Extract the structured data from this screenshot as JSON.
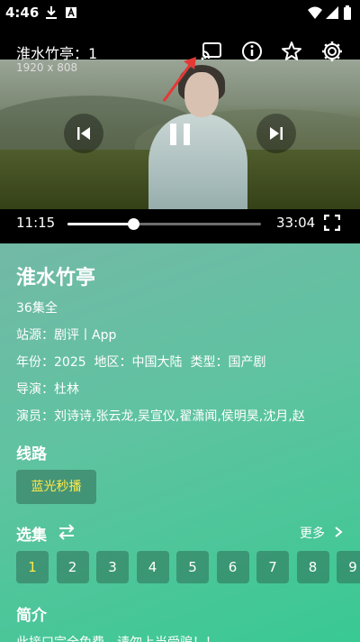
{
  "status_bar": {
    "time": "4:46"
  },
  "player": {
    "title": "淮水竹亭：1",
    "resolution": "1920 x 808",
    "current_time": "11:15",
    "duration": "33:04",
    "progress": 0.34
  },
  "details": {
    "title": "淮水竹亭",
    "episodes_total": "36集全",
    "source_label": "站源：",
    "source_value": "剧评丨App",
    "year_label": "年份：",
    "year_value": "2025",
    "region_label": "地区：",
    "region_value": "中国大陆",
    "type_label": "类型：",
    "type_value": "国产剧",
    "director_label": "导演：",
    "director_value": "杜林",
    "cast_label": "演员：",
    "cast_value": "刘诗诗,张云龙,吴宣仪,翟潇闻,侯明昊,沈月,赵"
  },
  "routes": {
    "heading": "线路",
    "items": [
      "蓝光秒播"
    ]
  },
  "episodes": {
    "heading": "选集",
    "more_label": "更多",
    "items": [
      "1",
      "2",
      "3",
      "4",
      "5",
      "6",
      "7",
      "8",
      "9"
    ],
    "active_index": 0
  },
  "intro": {
    "heading": "简介",
    "text": "此接口完全免费，请勿上当受骗！！"
  },
  "colors": {
    "accent_yellow": "#ffe94a",
    "annotation_arrow": "#e53935"
  }
}
